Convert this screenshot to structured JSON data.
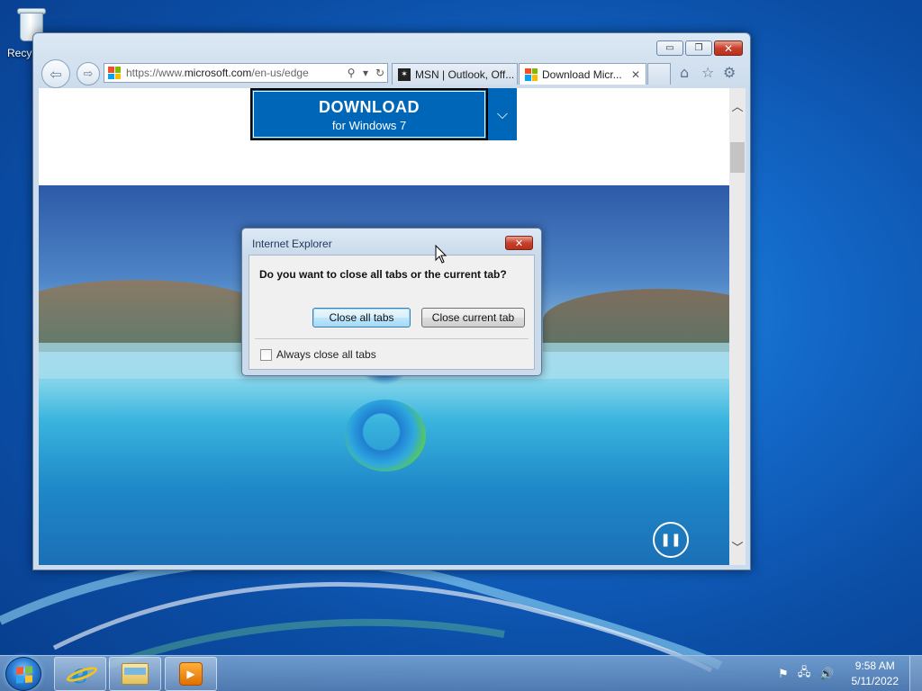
{
  "desktop": {
    "icons": [
      {
        "label": "Recy"
      }
    ]
  },
  "browser": {
    "address_url_prefix": "https://www.",
    "address_url_domain": "microsoft.com",
    "address_url_path": "/en-us/edge",
    "tabs": [
      {
        "label": "MSN | Outlook, Off..."
      },
      {
        "label": "Download Micr..."
      }
    ],
    "page": {
      "download_title": "DOWNLOAD",
      "download_subtitle": "for Windows 7"
    }
  },
  "dialog": {
    "title": "Internet Explorer",
    "question": "Do you want to close all tabs or the current tab?",
    "close_all_label": "Close all tabs",
    "close_current_label": "Close current tab",
    "checkbox_label": "Always close all tabs",
    "checkbox_checked": false
  },
  "taskbar": {
    "clock_time": "9:58 AM",
    "clock_date": "5/11/2022"
  },
  "colors": {
    "edge_blue": "#0067b8",
    "close_red": "#c8402c"
  }
}
